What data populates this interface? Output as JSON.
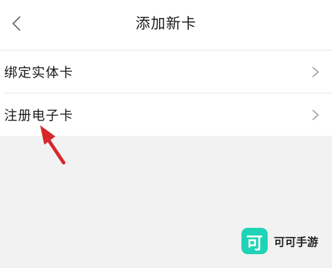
{
  "header": {
    "title": "添加新卡",
    "back_icon": "chevron-left-icon"
  },
  "menu": {
    "items": [
      {
        "label": "绑定实体卡",
        "icon": "chevron-right-icon"
      },
      {
        "label": "注册电子卡",
        "icon": "chevron-right-icon"
      }
    ]
  },
  "annotation": {
    "arrow_color": "#d7272b",
    "points_to": "注册电子卡"
  },
  "watermark": {
    "logo_char": "可",
    "text": "可可手游",
    "logo_color": "#1fd3b6"
  }
}
